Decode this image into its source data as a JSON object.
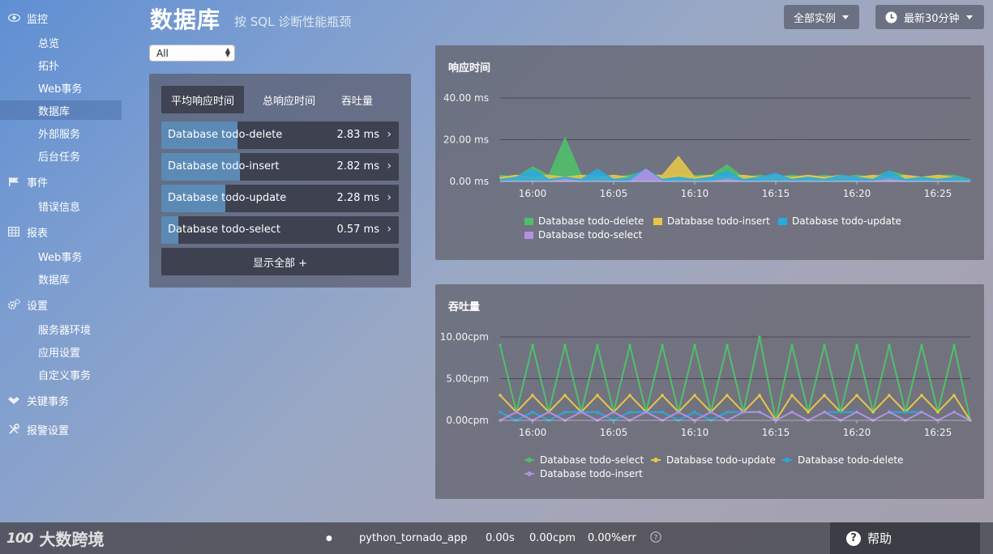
{
  "sidebar": {
    "groups": [
      {
        "label": "监控",
        "icon": "eye-icon",
        "items": [
          "总览",
          "拓扑",
          "Web事务",
          "数据库",
          "外部服务",
          "后台任务"
        ]
      },
      {
        "label": "事件",
        "icon": "flag-icon",
        "items": [
          "错误信息"
        ]
      },
      {
        "label": "报表",
        "icon": "table-icon",
        "items": [
          "Web事务",
          "数据库"
        ]
      },
      {
        "label": "设置",
        "icon": "gears-icon",
        "items": [
          "服务器环境",
          "应用设置",
          "自定义事务"
        ]
      },
      {
        "label": "关键事务",
        "icon": "handshake-icon",
        "items": []
      },
      {
        "label": "报警设置",
        "icon": "wrench-icon",
        "items": []
      }
    ],
    "active_item": "数据库"
  },
  "header": {
    "title": "数据库",
    "subtitle": "按 SQL 诊断性能瓶颈",
    "instances_label": "全部实例",
    "time_label": "最新30分钟"
  },
  "filter": {
    "selected": "All"
  },
  "db_panel": {
    "tabs": [
      "平均响应时间",
      "总响应时间",
      "吞吐量"
    ],
    "active_tab": "平均响应时间",
    "rows": [
      {
        "label": "Database todo-delete",
        "value": "2.83 ms",
        "fraction": 0.32
      },
      {
        "label": "Database todo-insert",
        "value": "2.82 ms",
        "fraction": 0.33
      },
      {
        "label": "Database todo-update",
        "value": "2.28 ms",
        "fraction": 0.27
      },
      {
        "label": "Database todo-select",
        "value": "0.57 ms",
        "fraction": 0.07
      }
    ],
    "show_all_label": "显示全部 +"
  },
  "chart_data": [
    {
      "type": "area",
      "title": "响应时间",
      "x_ticks": [
        "16:00",
        "16:05",
        "16:10",
        "16:15",
        "16:20",
        "16:25"
      ],
      "y_ticks": [
        "40.00 ms",
        "20.00 ms",
        "0.00 ms"
      ],
      "ylim": [
        0,
        40
      ],
      "unit": "ms",
      "x": [
        "15:58",
        "15:59",
        "16:00",
        "16:01",
        "16:02",
        "16:03",
        "16:04",
        "16:05",
        "16:06",
        "16:07",
        "16:08",
        "16:09",
        "16:10",
        "16:11",
        "16:12",
        "16:13",
        "16:14",
        "16:15",
        "16:16",
        "16:17",
        "16:18",
        "16:19",
        "16:20",
        "16:21",
        "16:22",
        "16:23",
        "16:24",
        "16:25",
        "16:26",
        "16:27"
      ],
      "series": [
        {
          "name": "Database todo-delete",
          "color": "#4fc06a",
          "values": [
            3,
            2,
            7,
            3,
            21,
            3,
            3,
            2,
            3,
            5,
            2,
            3,
            3,
            3,
            8,
            2,
            3,
            2,
            3,
            2,
            3,
            2,
            3,
            2,
            5,
            3,
            2,
            3,
            3,
            1
          ]
        },
        {
          "name": "Database todo-insert",
          "color": "#e6c649",
          "values": [
            2,
            3,
            2,
            3,
            2,
            3,
            2,
            3,
            2,
            3,
            3,
            12,
            2,
            3,
            2,
            3,
            2,
            3,
            2,
            3,
            2,
            3,
            2,
            3,
            2,
            3,
            2,
            3,
            2,
            1
          ]
        },
        {
          "name": "Database todo-update",
          "color": "#2aa8e0",
          "values": [
            1,
            2,
            6,
            1,
            2,
            1,
            6,
            1,
            2,
            6,
            1,
            2,
            1,
            2,
            5,
            1,
            2,
            4,
            1,
            2,
            1,
            3,
            2,
            1,
            5,
            1,
            2,
            1,
            2,
            1
          ]
        },
        {
          "name": "Database todo-select",
          "color": "#b48fe3",
          "values": [
            0,
            0,
            0,
            0,
            1,
            0,
            0,
            0,
            0,
            6,
            0,
            0,
            0,
            0,
            1,
            0,
            0,
            0,
            0,
            0,
            0,
            0,
            0,
            0,
            1,
            0,
            0,
            0,
            0,
            0
          ]
        }
      ]
    },
    {
      "type": "line",
      "title": "吞吐量",
      "x_ticks": [
        "16:00",
        "16:05",
        "16:10",
        "16:15",
        "16:20",
        "16:25"
      ],
      "y_ticks": [
        "10.00cpm",
        "5.00cpm",
        "0.00cpm"
      ],
      "ylim": [
        0,
        10
      ],
      "unit": "cpm",
      "x": [
        "15:58",
        "15:59",
        "16:00",
        "16:01",
        "16:02",
        "16:03",
        "16:04",
        "16:05",
        "16:06",
        "16:07",
        "16:08",
        "16:09",
        "16:10",
        "16:11",
        "16:12",
        "16:13",
        "16:14",
        "16:15",
        "16:16",
        "16:17",
        "16:18",
        "16:19",
        "16:20",
        "16:21",
        "16:22",
        "16:23",
        "16:24",
        "16:25",
        "16:26",
        "16:27"
      ],
      "series": [
        {
          "name": "Database todo-select",
          "color": "#4fc06a",
          "values": [
            9,
            1,
            9,
            1,
            9,
            1,
            9,
            1,
            9,
            1,
            9,
            1,
            9,
            1,
            9,
            1,
            10,
            0,
            9,
            1,
            9,
            1,
            9,
            1,
            9,
            1,
            9,
            1,
            9,
            0
          ]
        },
        {
          "name": "Database todo-update",
          "color": "#e6c649",
          "values": [
            3,
            1,
            3,
            1,
            3,
            1,
            3,
            1,
            3,
            1,
            3,
            1,
            3,
            1,
            3,
            1,
            3,
            0,
            3,
            1,
            3,
            1,
            3,
            1,
            3,
            1,
            3,
            1,
            3,
            0
          ]
        },
        {
          "name": "Database todo-delete",
          "color": "#2aa8e0",
          "values": [
            1,
            0,
            1,
            0,
            1,
            1,
            1,
            0,
            1,
            1,
            1,
            0,
            1,
            0,
            1,
            1,
            1,
            0,
            1,
            0,
            1,
            1,
            1,
            0,
            1,
            1,
            1,
            0,
            1,
            0
          ]
        },
        {
          "name": "Database todo-insert",
          "color": "#b48fe3",
          "values": [
            0,
            1,
            0,
            1,
            0,
            1,
            0,
            1,
            0,
            1,
            0,
            1,
            0,
            1,
            0,
            1,
            1,
            0,
            1,
            0,
            1,
            0,
            1,
            0,
            1,
            0,
            1,
            0,
            1,
            0
          ]
        }
      ]
    }
  ],
  "footer": {
    "brand_mark": "100",
    "brand_text": "大数跨境",
    "dot": "●",
    "app_name": "python_tornado_app",
    "response_time": "0.00s",
    "throughput": "0.00cpm",
    "error_rate": "0.00%err",
    "help_label": "帮助"
  }
}
